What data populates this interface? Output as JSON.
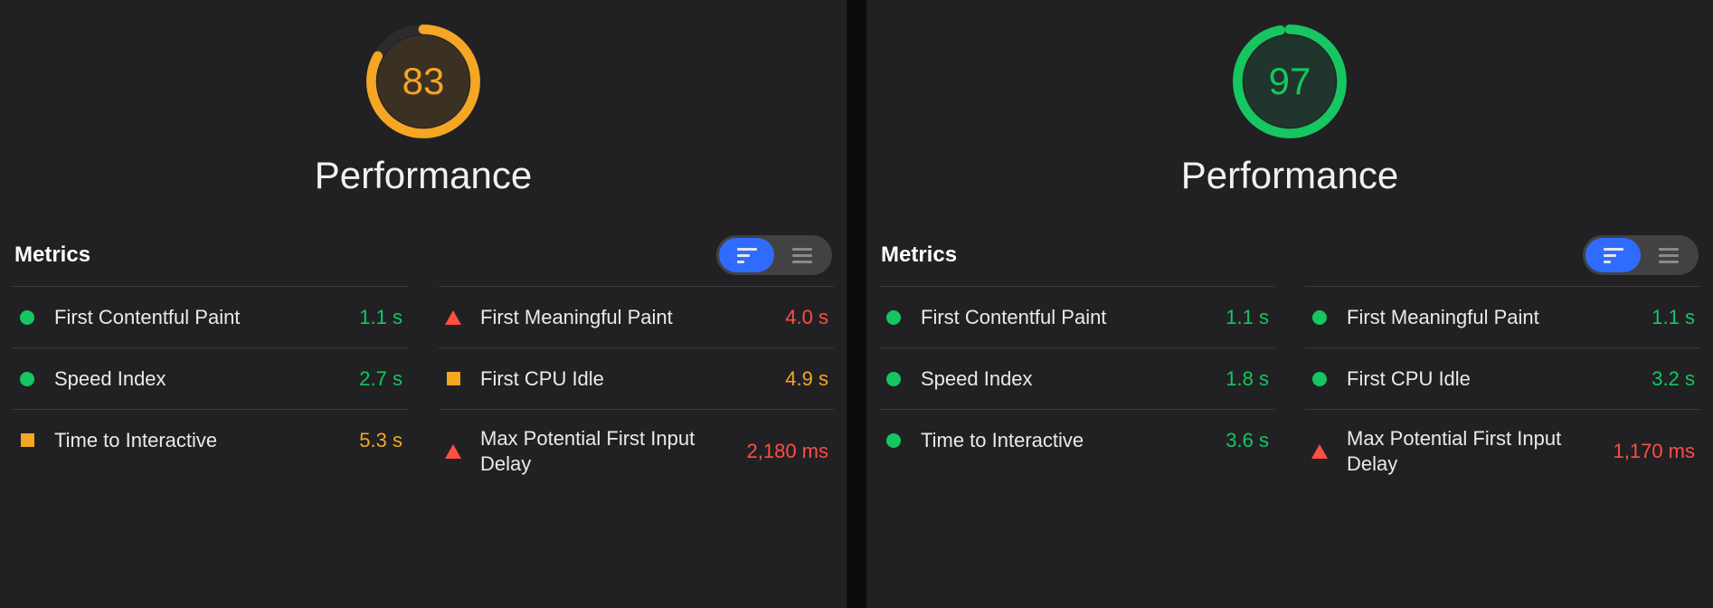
{
  "panels": [
    {
      "score": "83",
      "scoreLevel": "orange",
      "title": "Performance",
      "metricsLabel": "Metrics",
      "colA": [
        {
          "name": "First Contentful Paint",
          "value": "1.1 s",
          "level": "green"
        },
        {
          "name": "Speed Index",
          "value": "2.7 s",
          "level": "green"
        },
        {
          "name": "Time to Interactive",
          "value": "5.3 s",
          "level": "orange"
        }
      ],
      "colB": [
        {
          "name": "First Meaningful Paint",
          "value": "4.0 s",
          "level": "red"
        },
        {
          "name": "First CPU Idle",
          "value": "4.9 s",
          "level": "orange"
        },
        {
          "name": "Max Potential First Input Delay",
          "value": "2,180 ms",
          "level": "red"
        }
      ]
    },
    {
      "score": "97",
      "scoreLevel": "green",
      "title": "Performance",
      "metricsLabel": "Metrics",
      "colA": [
        {
          "name": "First Contentful Paint",
          "value": "1.1 s",
          "level": "green"
        },
        {
          "name": "Speed Index",
          "value": "1.8 s",
          "level": "green"
        },
        {
          "name": "Time to Interactive",
          "value": "3.6 s",
          "level": "green"
        }
      ],
      "colB": [
        {
          "name": "First Meaningful Paint",
          "value": "1.1 s",
          "level": "green"
        },
        {
          "name": "First CPU Idle",
          "value": "3.2 s",
          "level": "green"
        },
        {
          "name": "Max Potential First Input Delay",
          "value": "1,170 ms",
          "level": "red"
        }
      ]
    }
  ]
}
